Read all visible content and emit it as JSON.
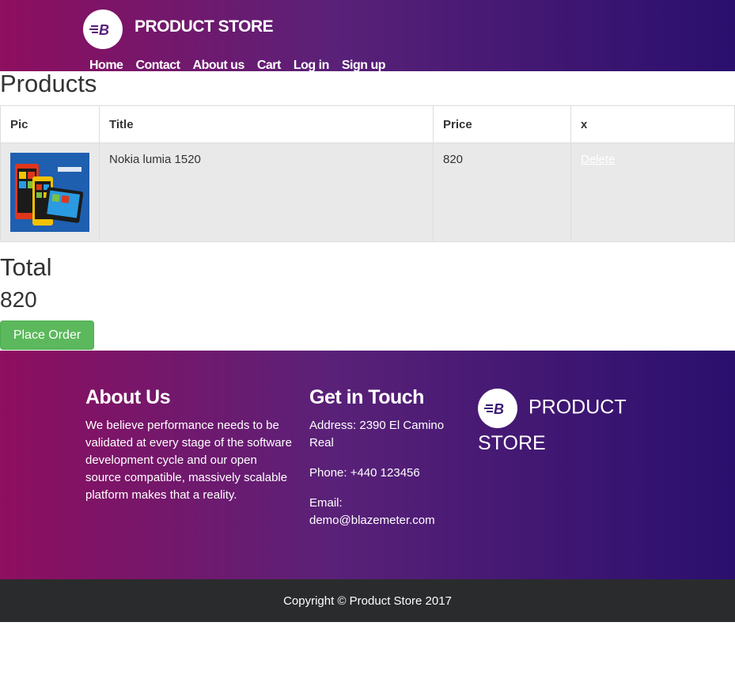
{
  "navbar": {
    "brand": "PRODUCT STORE",
    "links": [
      "Home",
      "Contact",
      "About us",
      "Cart",
      "Log in",
      "Sign up"
    ]
  },
  "cart": {
    "title": "Products",
    "columns": [
      "Pic",
      "Title",
      "Price",
      "x"
    ],
    "rows": [
      {
        "title": "Nokia lumia 1520",
        "price": "820",
        "action": "Delete"
      }
    ],
    "total_label": "Total",
    "total_value": "820",
    "place_order": "Place Order"
  },
  "footer": {
    "about_title": "About Us",
    "about_text": "We believe performance needs to be validated at every stage of the software development cycle and our open source compatible, massively scalable platform makes that a reality.",
    "touch_title": "Get in Touch",
    "address": "Address: 2390 El Camino Real",
    "phone": "Phone: +440 123456",
    "email_label": "Email:",
    "email": "demo@blazemeter.com",
    "brand": "PRODUCT STORE",
    "copyright": "Copyright © Product Store 2017"
  },
  "colors": {
    "gradient_start": "#8e0e5f",
    "gradient_end": "#2a0f6e",
    "place_order_bg": "#5cb85c",
    "copyright_bg": "#2a2b2c"
  },
  "icons": {
    "brand_logo": "blazemeter-logo-icon",
    "product_image": "phone-image"
  }
}
